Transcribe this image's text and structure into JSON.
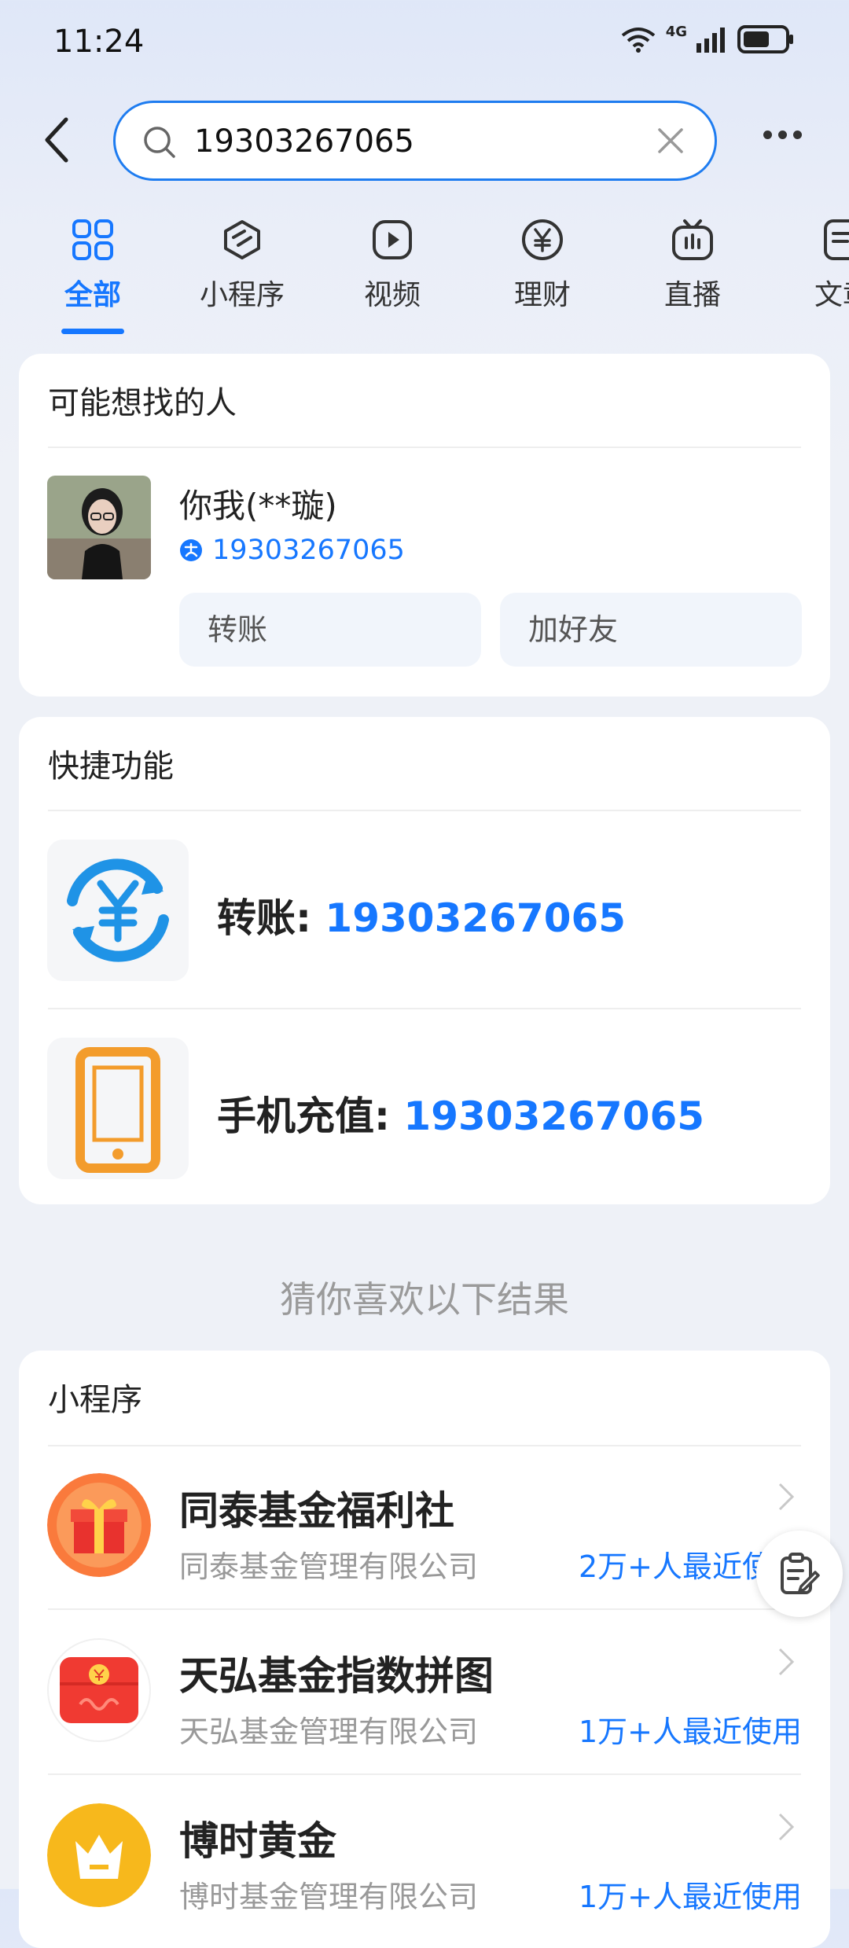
{
  "status": {
    "time": "11:24",
    "network": "4G"
  },
  "search": {
    "query": "19303267065"
  },
  "tabs": [
    {
      "label": "全部",
      "icon": "grid-icon"
    },
    {
      "label": "小程序",
      "icon": "mini-program-icon"
    },
    {
      "label": "视频",
      "icon": "video-icon"
    },
    {
      "label": "理财",
      "icon": "yen-circle-icon"
    },
    {
      "label": "直播",
      "icon": "tv-icon"
    },
    {
      "label": "文章",
      "icon": "document-icon"
    }
  ],
  "people": {
    "title": "可能想找的人",
    "name": "你我(**璇)",
    "phone": "19303267065",
    "transfer_label": "转账",
    "add_friend_label": "加好友"
  },
  "quick": {
    "title": "快捷功能",
    "transfer": {
      "label": "转账: ",
      "number": "19303267065"
    },
    "recharge": {
      "label": "手机充值: ",
      "number": "19303267065"
    }
  },
  "guess": {
    "text": "猜你喜欢以下结果"
  },
  "mini_programs": {
    "title": "小程序",
    "items": [
      {
        "name": "同泰基金福利社",
        "company": "同泰基金管理有限公司",
        "users": "2万+人最近使用"
      },
      {
        "name": "天弘基金指数拼图",
        "company": "天弘基金管理有限公司",
        "users": "1万+人最近使用"
      },
      {
        "name": "博时黄金",
        "company": "博时基金管理有限公司",
        "users": "1万+人最近使用"
      }
    ]
  },
  "colors": {
    "accent": "#1677ff",
    "orange": "#f39c2c"
  }
}
